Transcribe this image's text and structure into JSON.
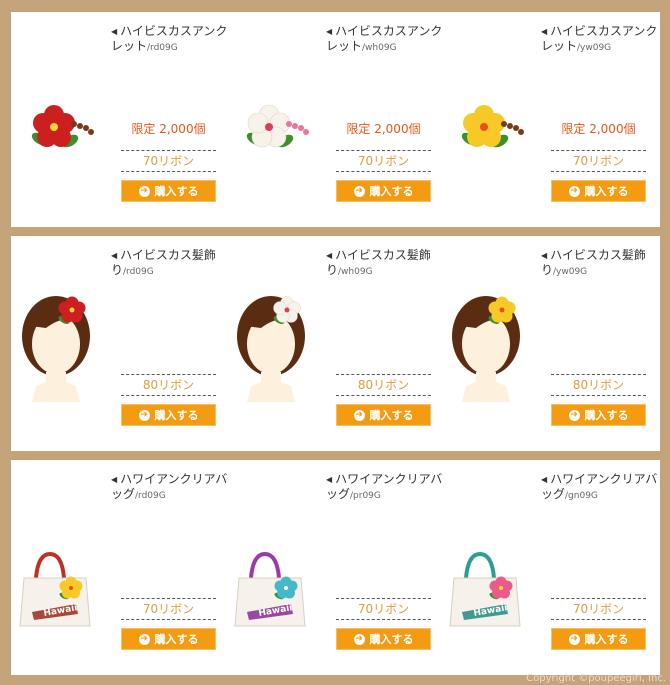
{
  "panels": [
    {
      "items": [
        {
          "name": "ハイビスカスアンクレット",
          "code": "/rd09G",
          "limit": "限定 2,000個",
          "price": "70リボン",
          "buy": "購入する",
          "flower_color": "#cc1f1f",
          "center_color": "#f6d63b"
        },
        {
          "name": "ハイビスカスアンクレット",
          "code": "/wh09G",
          "limit": "限定 2,000個",
          "price": "70リボン",
          "buy": "購入する",
          "flower_color": "#f7f3ea",
          "center_color": "#d94060"
        },
        {
          "name": "ハイビスカスアンクレット",
          "code": "/yw09G",
          "limit": "限定 2,000個",
          "price": "70リボン",
          "buy": "購入する",
          "flower_color": "#f6c926",
          "center_color": "#e84f1f"
        }
      ]
    },
    {
      "items": [
        {
          "name": "ハイビスカス髪飾り",
          "code": "/rd09G",
          "price": "80リボン",
          "buy": "購入する",
          "flower_color": "#cc1f1f",
          "center_color": "#f6d63b"
        },
        {
          "name": "ハイビスカス髪飾り",
          "code": "/wh09G",
          "price": "80リボン",
          "buy": "購入する",
          "flower_color": "#f7f3ea",
          "center_color": "#d94060"
        },
        {
          "name": "ハイビスカス髪飾り",
          "code": "/yw09G",
          "price": "80リボン",
          "buy": "購入する",
          "flower_color": "#f6c926",
          "center_color": "#e84f1f"
        }
      ]
    },
    {
      "items": [
        {
          "name": "ハワイアンクリアバッグ",
          "code": "/rd09G",
          "price": "70リボン",
          "buy": "購入する",
          "strap_color": "#c0311f",
          "flower_color": "#f6c926",
          "print_color": "#9a2a1a",
          "bag_text": "Hawaii"
        },
        {
          "name": "ハワイアンクリアバッグ",
          "code": "/pr09G",
          "price": "70リボン",
          "buy": "購入する",
          "strap_color": "#9b3aa8",
          "flower_color": "#45b8c9",
          "print_color": "#8a2b96",
          "bag_text": "Hawaii"
        },
        {
          "name": "ハワイアンクリアバッグ",
          "code": "/gn09G",
          "price": "70リボン",
          "buy": "購入する",
          "strap_color": "#2a9e92",
          "flower_color": "#ea5a8a",
          "print_color": "#1f8c80",
          "bag_text": "Hawaii"
        }
      ]
    }
  ],
  "copyright": "Copyright ©poupeegirl, Inc."
}
